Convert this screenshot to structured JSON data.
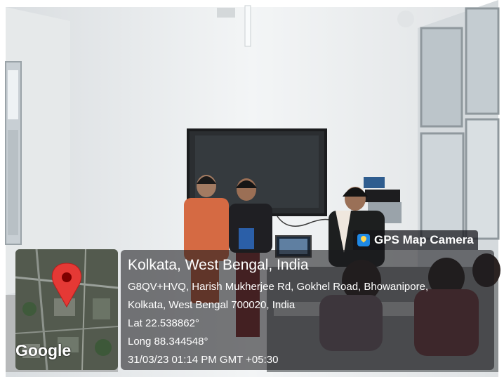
{
  "watermark": {
    "app_name": "GPS Map Camera",
    "logo_icon": "map-pin-logo"
  },
  "location": {
    "title": "Kolkata, West Bengal, India",
    "address_line1": "G8QV+HVQ, Harish Mukherjee Rd, Gokhel Road, Bhowanipore,",
    "address_line2": "Kolkata, West Bengal 700020, India",
    "lat": "Lat 22.538862°",
    "long": "Long 88.344548°",
    "timestamp": "31/03/23 01:14 PM GMT +05:30"
  },
  "map": {
    "attribution": "Google",
    "marker_icon": "map-marker-icon",
    "marker_color": "#e53935"
  }
}
